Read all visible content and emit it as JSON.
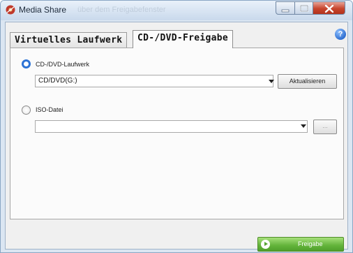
{
  "window": {
    "title": "Media Share",
    "background_title": "über dem Freigabefenster",
    "accent": "#2d73d5",
    "close_color": "#c7452d"
  },
  "tabs": [
    {
      "label": "Virtuelles Laufwerk",
      "selected": false
    },
    {
      "label": "CD-/DVD-Freigabe",
      "selected": true
    }
  ],
  "help": {
    "glyph": "?"
  },
  "drive_option": {
    "label": "CD-/DVD-Laufwerk",
    "selected": true,
    "select_value": "CD/DVD(G:)",
    "refresh_label": "Aktualisieren"
  },
  "iso_option": {
    "label": "ISO-Datei",
    "selected": false,
    "select_value": "",
    "browse_label": "..."
  },
  "footer": {
    "share_label": "Freigabe",
    "share_color": "#62b33a"
  }
}
